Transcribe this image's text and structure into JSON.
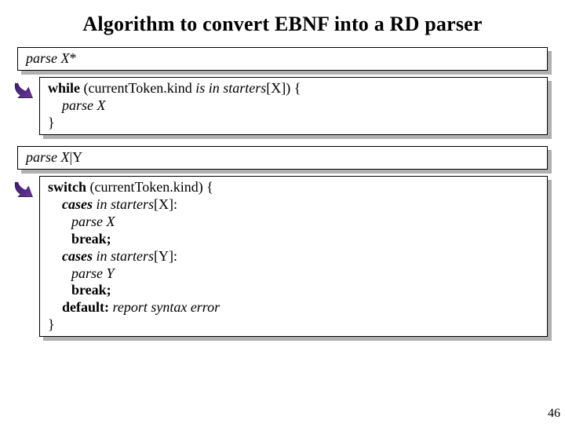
{
  "title": "Algorithm to convert EBNF into a RD parser",
  "rule1": {
    "label_italic": "parse X",
    "label_suffix": "*"
  },
  "code1": {
    "l1_a": "while ",
    "l1_b": "(currentToken.kind ",
    "l1_c": "is in starters",
    "l1_d": "[X]) {",
    "l2": "parse X",
    "l3": "}"
  },
  "rule2": {
    "label_italic": "parse X",
    "label_suffix": "|Y"
  },
  "code2": {
    "l1_a": "switch ",
    "l1_b": "(currentToken.kind) {",
    "l2_a": "cases in starters",
    "l2_b": "[X]:",
    "l3": "parse X",
    "l4": "break;",
    "l5_a": "cases in starters",
    "l5_b": "[Y]:",
    "l6": "parse Y",
    "l7": "break;",
    "l8_a": "default: ",
    "l8_b": "report syntax error",
    "l9": "}"
  },
  "pagenum": "46"
}
